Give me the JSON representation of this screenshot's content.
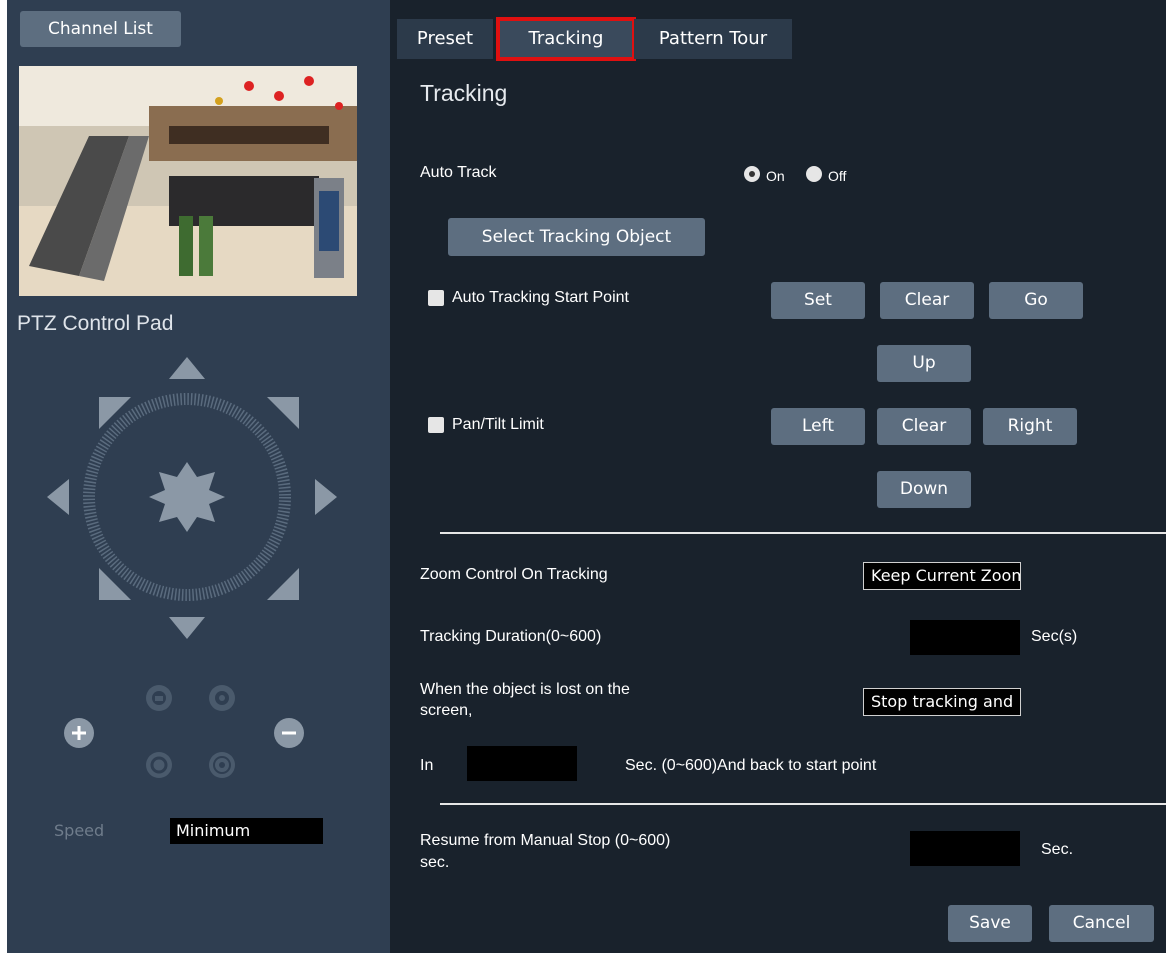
{
  "left": {
    "channel_list_label": "Channel List",
    "ptz_title": "PTZ Control Pad",
    "speed_label": "Speed",
    "speed_value": "Minimum"
  },
  "tabs": [
    {
      "label": "Preset"
    },
    {
      "label": "Tracking",
      "active": true
    },
    {
      "label": "Pattern Tour"
    }
  ],
  "tracking": {
    "title": "Tracking",
    "auto_track_label": "Auto Track",
    "radio_on_label": "On",
    "radio_off_label": "Off",
    "auto_track_selected": "On",
    "select_object_label": "Select Tracking Object",
    "start_point_label": "Auto Tracking Start Point",
    "set_label": "Set",
    "clear_label": "Clear",
    "go_label": "Go",
    "up_label": "Up",
    "pan_tilt_label": "Pan/Tilt Limit",
    "left_label": "Left",
    "clear2_label": "Clear",
    "right_label": "Right",
    "down_label": "Down",
    "zoom_control_label": "Zoom Control On Tracking",
    "zoom_control_value": "Keep Current Zoom",
    "duration_label": "Tracking Duration(0~600)",
    "duration_unit": "Sec(s)",
    "lost_label_line1": "When the object is lost on the",
    "lost_label_line2": "screen,",
    "lost_value": "Stop tracking and",
    "in_label": "In",
    "in_suffix": "Sec. (0~600)And back to start point",
    "resume_label_line1": "Resume from Manual Stop (0~600)",
    "resume_label_line2": "sec.",
    "resume_unit": "Sec.",
    "save_label": "Save",
    "cancel_label": "Cancel"
  },
  "colors": {
    "left_bg": "#2f3e51",
    "right_bg": "#19222c",
    "button_bg": "#5d6e80",
    "highlight": "#e01010"
  }
}
